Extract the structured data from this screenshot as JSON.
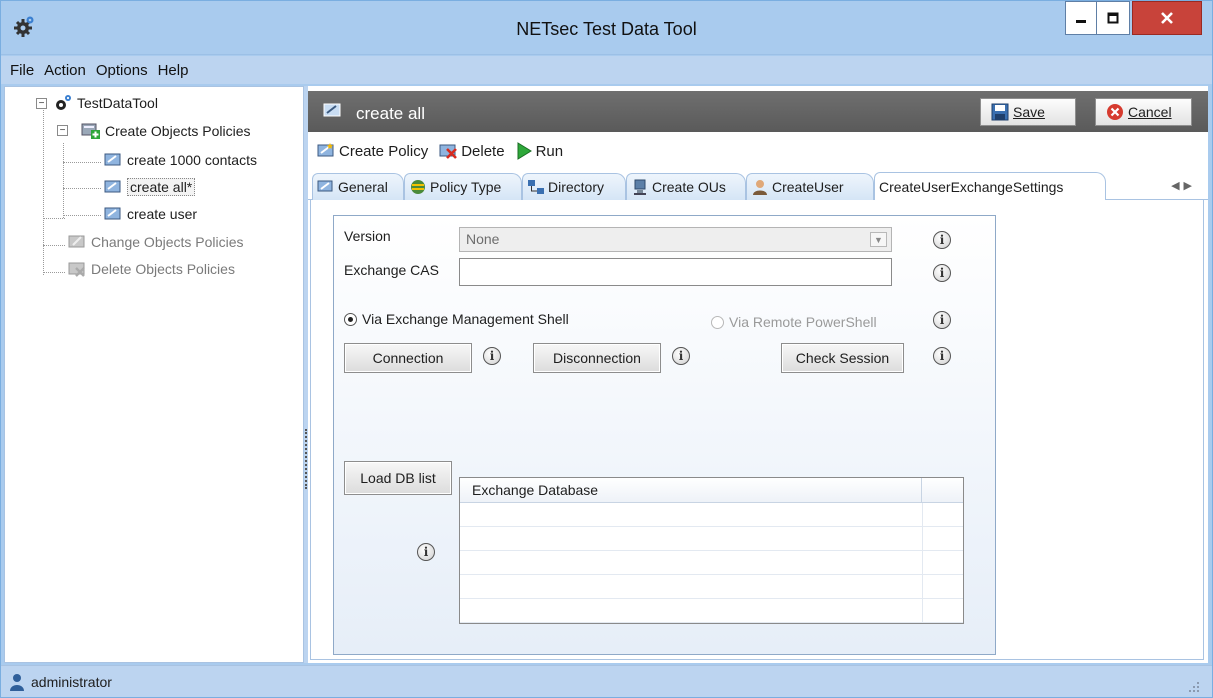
{
  "window": {
    "title": "NETsec Test Data Tool"
  },
  "menu": [
    "File",
    "Action",
    "Options",
    "Help"
  ],
  "tree": {
    "root": "TestDataTool",
    "create_group": "Create Objects Policies",
    "items": [
      "create 1000 contacts",
      "create all*",
      "create user"
    ],
    "change_group": "Change Objects Policies",
    "delete_group": "Delete Objects Policies"
  },
  "header": {
    "title": "create all",
    "save_label": "Save",
    "cancel_label": "Cancel"
  },
  "toolbar": {
    "create_policy": "Create Policy",
    "delete": "Delete",
    "run": "Run"
  },
  "tabs": [
    "General",
    "Policy Type",
    "Directory",
    "Create OUs",
    "CreateUser",
    "CreateUserExchangeSettings"
  ],
  "form": {
    "version_label": "Version",
    "version_value": "None",
    "exchange_cas_label": "Exchange CAS",
    "exchange_cas_value": "",
    "radio_ems": "Via Exchange Management Shell",
    "radio_remote": "Via Remote PowerShell",
    "connection_button": "Connection",
    "disconnection_button": "Disconnection",
    "check_session_button": "Check Session",
    "load_db_button": "Load DB list",
    "grid_header": "Exchange Database"
  },
  "status": {
    "user": "administrator"
  },
  "colors": {
    "accent": "#a9cbee",
    "header": "#5f5f5f",
    "close": "#c8433a"
  }
}
